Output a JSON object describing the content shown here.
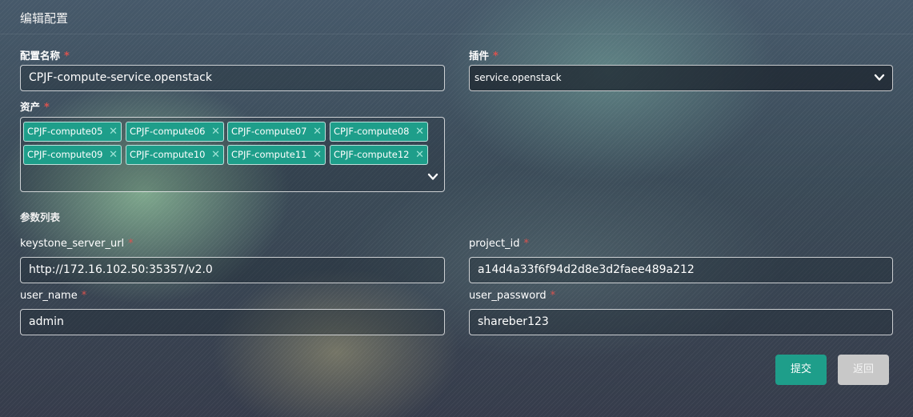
{
  "header": {
    "title": "编辑配置"
  },
  "form": {
    "config_name": {
      "label": "配置名称",
      "value": "CPJF-compute-service.openstack"
    },
    "plugin": {
      "label": "插件",
      "selected": "service.openstack"
    },
    "assets": {
      "label": "资产",
      "tags": [
        "CPJF-compute05",
        "CPJF-compute06",
        "CPJF-compute07",
        "CPJF-compute08",
        "CPJF-compute09",
        "CPJF-compute10",
        "CPJF-compute11",
        "CPJF-compute12"
      ]
    },
    "required_mark": "*",
    "tag_remove": "✕"
  },
  "params": {
    "title": "参数列表",
    "keystone_server_url": {
      "label": "keystone_server_url",
      "value": "http://172.16.102.50:35357/v2.0"
    },
    "project_id": {
      "label": "project_id",
      "value": "a14d4a33f6f94d2d8e3d2faee489a212"
    },
    "user_name": {
      "label": "user_name",
      "value": "admin"
    },
    "user_password": {
      "label": "user_password",
      "value": "shareber123"
    }
  },
  "buttons": {
    "submit": "提交",
    "back": "返回"
  },
  "colors": {
    "accent": "#1e9e8a",
    "required": "#d9534f",
    "disabled_button": "#c8c8c8"
  },
  "icons": {
    "dropdown": "chevron-down-icon",
    "remove": "close-icon"
  }
}
